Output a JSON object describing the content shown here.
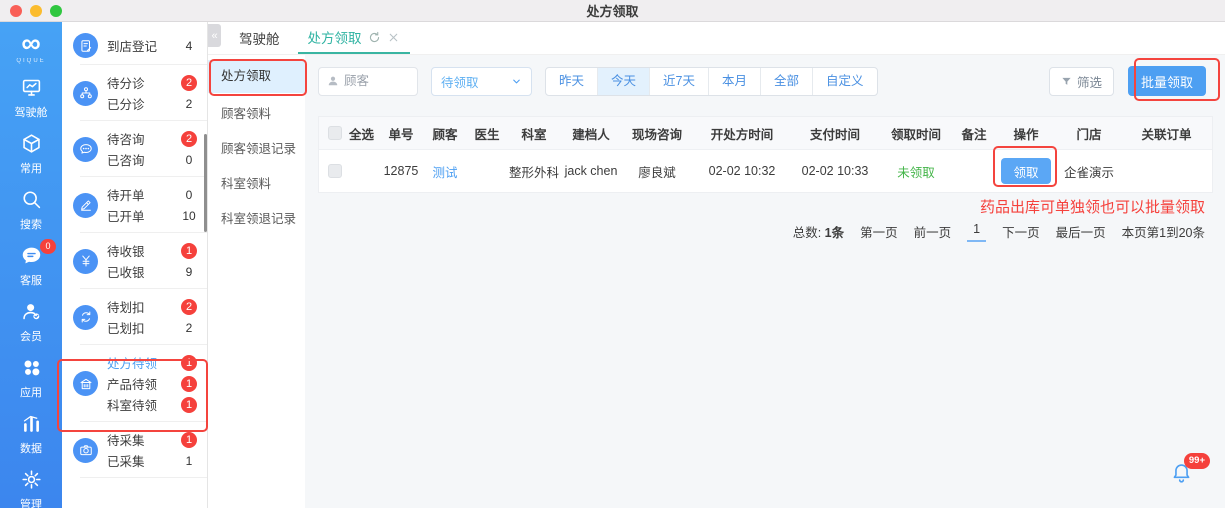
{
  "window": {
    "title": "处方领取"
  },
  "icon_sidebar": {
    "brand": {
      "logo": "∞",
      "name": "QIQUE"
    },
    "items": [
      {
        "label": "驾驶舱",
        "icon": "dashboard-monitor-icon"
      },
      {
        "label": "常用",
        "icon": "cube-icon"
      },
      {
        "label": "搜索",
        "icon": "search-icon"
      },
      {
        "label": "客服",
        "icon": "chat-support-icon",
        "badge": "0"
      },
      {
        "label": "会员",
        "icon": "member-icon"
      },
      {
        "label": "应用",
        "icon": "apps-icon"
      },
      {
        "label": "数据",
        "icon": "data-chart-icon"
      },
      {
        "label": "管理",
        "icon": "settings-gear-icon"
      }
    ]
  },
  "workflow_sidebar": {
    "groups": [
      {
        "icon": "register-doc-icon",
        "rows": [
          {
            "label": "到店登记",
            "count": "4",
            "alert": false
          }
        ]
      },
      {
        "icon": "triage-network-icon",
        "rows": [
          {
            "label": "待分诊",
            "count": "2",
            "alert": true
          },
          {
            "label": "已分诊",
            "count": "2",
            "alert": false
          }
        ]
      },
      {
        "icon": "consult-chat-icon",
        "rows": [
          {
            "label": "待咨询",
            "count": "2",
            "alert": true
          },
          {
            "label": "已咨询",
            "count": "0",
            "alert": false
          }
        ]
      },
      {
        "icon": "order-pen-icon",
        "rows": [
          {
            "label": "待开单",
            "count": "0",
            "alert": false
          },
          {
            "label": "已开单",
            "count": "10",
            "alert": false
          }
        ]
      },
      {
        "icon": "cashier-yen-icon",
        "rows": [
          {
            "label": "待收银",
            "count": "1",
            "alert": true
          },
          {
            "label": "已收银",
            "count": "9",
            "alert": false
          }
        ]
      },
      {
        "icon": "deduct-cycle-icon",
        "rows": [
          {
            "label": "待划扣",
            "count": "2",
            "alert": true
          },
          {
            "label": "已划扣",
            "count": "2",
            "alert": false
          }
        ]
      },
      {
        "icon": "pickup-building-icon",
        "rows": [
          {
            "label": "处方待领",
            "count": "1",
            "alert": true,
            "active": true
          },
          {
            "label": "产品待领",
            "count": "1",
            "alert": true
          },
          {
            "label": "科室待领",
            "count": "1",
            "alert": true
          }
        ]
      },
      {
        "icon": "camera-icon",
        "rows": [
          {
            "label": "待采集",
            "count": "1",
            "alert": true
          },
          {
            "label": "已采集",
            "count": "1",
            "alert": false
          }
        ]
      }
    ]
  },
  "tab_bar": {
    "collapse": "«",
    "tabs": [
      {
        "label": "驾驶舱",
        "active": false
      },
      {
        "label": "处方领取",
        "active": true
      }
    ]
  },
  "submenu": {
    "items": [
      {
        "label": "处方领取",
        "active": true
      },
      {
        "label": "顾客领料"
      },
      {
        "label": "顾客领退记录"
      },
      {
        "label": "科室领料"
      },
      {
        "label": "科室领退记录"
      }
    ]
  },
  "filters": {
    "customer_placeholder": "顾客",
    "status_value": "待领取",
    "date_options": [
      "昨天",
      "今天",
      "近7天",
      "本月",
      "全部",
      "自定义"
    ],
    "active_date": "今天",
    "filter_label": "筛选",
    "batch_label": "批量领取"
  },
  "table": {
    "select_all": "全选",
    "columns": [
      {
        "label": "单号"
      },
      {
        "label": "顾客"
      },
      {
        "label": "医生"
      },
      {
        "label": "科室"
      },
      {
        "label": "建档人"
      },
      {
        "label": "现场咨询"
      },
      {
        "label": "开处方时间"
      },
      {
        "label": "支付时间"
      },
      {
        "label": "领取时间"
      },
      {
        "label": "备注"
      },
      {
        "label": "操作"
      },
      {
        "label": "门店"
      },
      {
        "label": "关联订单"
      }
    ],
    "rows": [
      {
        "order_no": "12875",
        "customer": "测试",
        "doctor": "",
        "department": "整形外科",
        "creator": "jack chen",
        "consultant": "廖良斌",
        "prescribe_time": "02-02 10:32",
        "pay_time": "02-02 10:33",
        "pickup_status": "未领取",
        "remark": "",
        "action": "领取",
        "store": "企雀演示",
        "related_order": ""
      }
    ]
  },
  "annotation": {
    "note": "药品出库可单独领也可以批量领取"
  },
  "pagination": {
    "total_label": "总数:",
    "total_value": "1条",
    "first": "第一页",
    "prev": "前一页",
    "current": "1",
    "next": "下一页",
    "last": "最后一页",
    "range": "本页第1到20条"
  },
  "notification": {
    "badge": "99+"
  },
  "colors": {
    "sidebar_blue": "#3E8DF2",
    "accent_teal": "#2FB3A2",
    "alert_red": "#F5413C",
    "link_blue": "#4D9FF2",
    "success_green": "#44B549",
    "annotation_red": "#F4443E"
  }
}
